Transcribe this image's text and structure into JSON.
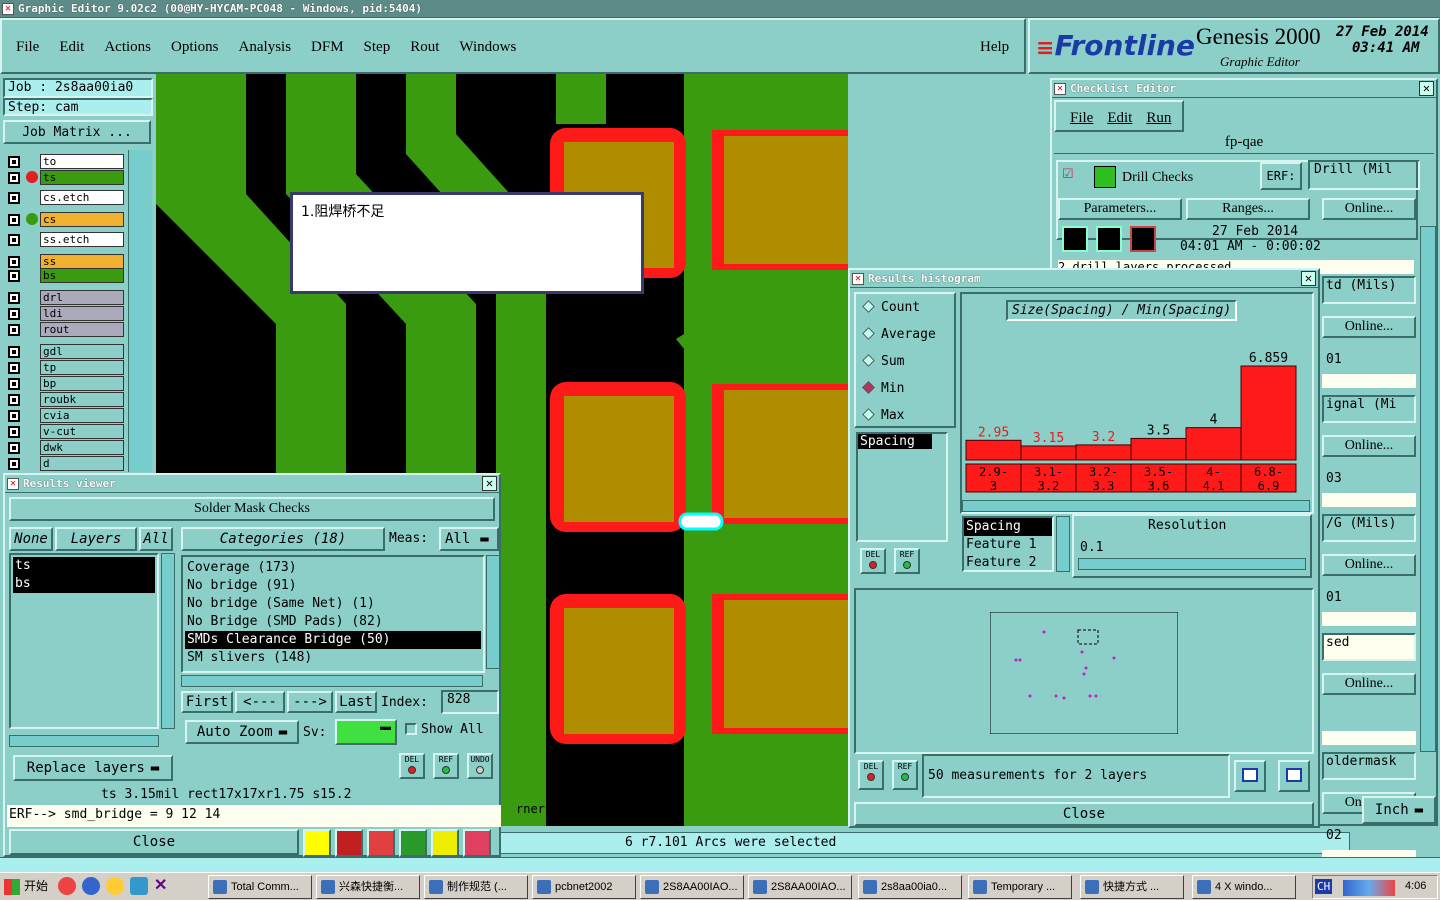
{
  "title_bar": "Graphic Editor 9.02c2 (00@HY-HYCAM-PC048 - Windows, pid:5404)",
  "menu": [
    "File",
    "Edit",
    "Actions",
    "Options",
    "Analysis",
    "DFM",
    "Step",
    "Rout",
    "Windows"
  ],
  "help": "Help",
  "logo": {
    "brand": "Frontline",
    "product": "Genesis 2000",
    "subtitle": "Graphic Editor",
    "date": "27 Feb 2014",
    "time": "03:41 AM"
  },
  "job": "Job : 2s8aa00ia0",
  "step": "Step: cam",
  "job_matrix": "Job Matrix ...",
  "layers": [
    "to",
    "ts",
    "cs.etch",
    "cs",
    "ss.etch",
    "ss",
    "bs",
    "drl",
    "ldi",
    "rout",
    "gdl",
    "tp",
    "bp",
    "roubk",
    "cvia",
    "v-cut",
    "dwk",
    "d"
  ],
  "annotation": "1.阻焊桥不足",
  "canvas_status": "rner",
  "arcs_status": "6 r7.101 Arcs were selected",
  "results_viewer": {
    "title": "Results viewer",
    "header": "Solder Mask Checks",
    "none": "None",
    "layers": "Layers",
    "all": "All",
    "categories": "Categories (18)",
    "meas_label": "Meas:",
    "meas_val": "All",
    "layer_items": [
      "ts",
      "bs"
    ],
    "category_items": [
      "Coverage (173)",
      "No bridge (91)",
      "No bridge (Same Net) (1)",
      "No Bridge (SMD Pads) (82)",
      "SMDs Clearance Bridge (50)",
      "SM slivers (148)"
    ],
    "first": "First",
    "prev": "<---",
    "next": "--->",
    "last": "Last",
    "index_label": "Index:",
    "index_val": "828",
    "auto_zoom": "Auto Zoom",
    "sv": "Sv:",
    "show_all": "Show All",
    "replace_layers": "Replace layers",
    "del": "DEL",
    "ref": "REF",
    "undo": "UNDO",
    "info_line": "ts 3.15mil rect17x17xr1.75 s15.2",
    "erf_line": "ERF--> smd_bridge = 9 12 14",
    "close": "Close"
  },
  "checklist": {
    "title": "Checklist Editor",
    "menu": [
      "File",
      "Edit",
      "Run"
    ],
    "name": "fp-qae",
    "drill_checks": "Drill Checks",
    "erf": "ERF:",
    "erf_val": "Drill (Mil",
    "parameters": "Parameters...",
    "ranges": "Ranges...",
    "online": "Online...",
    "date": "27 Feb 2014",
    "time": "04:01 AM - 0:00:02",
    "partial": "2 drill layers processed",
    "rows": [
      {
        "a": "td (Mils)",
        "b": "01"
      },
      {
        "a": "ignal (Mi",
        "b": "03"
      },
      {
        "a": "/G (Mils)",
        "b": "01"
      },
      {
        "a": "sed",
        "b": ""
      },
      {
        "a": "oldermask",
        "b": "02"
      }
    ],
    "inch": "Inch"
  },
  "histogram": {
    "title": "Results histogram",
    "heading": "Size(Spacing) / Min(Spacing)",
    "modes": [
      "Count",
      "Average",
      "Sum",
      "Min",
      "Max"
    ],
    "selected_mode": "Min",
    "list_item": "Spacing",
    "feature_items": [
      "Spacing",
      "Feature 1",
      "Feature 2"
    ],
    "resolution": "Resolution",
    "resolution_val": "0.1",
    "summary": "50 measurements for 2 layers",
    "close": "Close",
    "del": "DEL",
    "ref": "REF"
  },
  "chart_data": {
    "type": "bar",
    "title": "Size(Spacing) / Min(Spacing)",
    "categories": [
      "2.9-3",
      "3.1-3.2",
      "3.2-3.3",
      "3.5-3.6",
      "4-4.1",
      "6.8-6.9"
    ],
    "values": [
      2.95,
      3.15,
      3.2,
      3.5,
      4,
      6.859
    ]
  },
  "taskbar": {
    "start": "开始",
    "items": [
      "Total Comm...",
      "兴森快捷衡...",
      "制作规范 (...",
      "pcbnet2002",
      "2S8AA00IAO...",
      "2S8AA00IAO...",
      "2s8aa00ia0...",
      "Temporary ...",
      "快捷方式 ...",
      "4 X windo..."
    ],
    "lang": "CH",
    "clock": "4:06"
  },
  "colors": {
    "bg": "#8ccfc8",
    "green": "#3a9a10",
    "pad": "#b08c00",
    "red": "#ff1a1a"
  }
}
